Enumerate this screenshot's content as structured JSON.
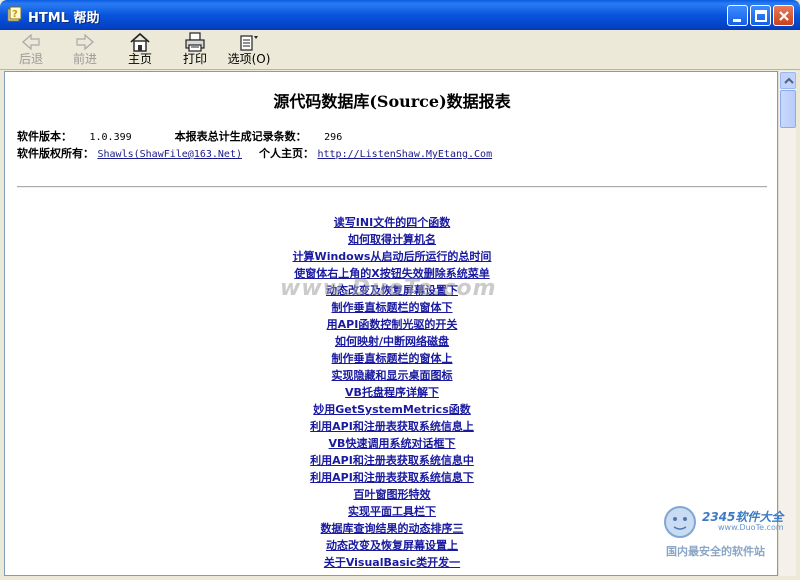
{
  "window": {
    "title": "HTML 帮助"
  },
  "toolbar": {
    "back_label": "后退",
    "forward_label": "前进",
    "home_label": "主页",
    "print_label": "打印",
    "options_label": "选项(O)"
  },
  "report": {
    "title": "源代码数据库(Source)数据报表",
    "version_label": "软件版本：",
    "version_value": "1.0.399",
    "count_label": "本报表总计生成记录条数：",
    "count_value": "296",
    "copyright_label": "软件版权所有：",
    "copyright_value": "Shawls(ShawFile@163.Net)",
    "homepage_label": "个人主页：",
    "homepage_value": "http://ListenShaw.MyEtang.Com"
  },
  "links": [
    "读写INI文件的四个函数",
    "如何取得计算机名",
    "计算Windows从启动后所运行的总时间",
    "使窗体右上角的X按钮失效删除系统菜单",
    "动态改变及恢复屏幕设置下",
    "制作垂直标题栏的窗体下",
    "用API函数控制光驱的开关",
    "如何映射/中断网络磁盘",
    "制作垂直标题栏的窗体上",
    "实现隐藏和显示桌面图标",
    "VB托盘程序详解下",
    "妙用GetSystemMetrics函数",
    "利用API和注册表获取系统信息上",
    "VB快速调用系统对话框下",
    "利用API和注册表获取系统信息中",
    "利用API和注册表获取系统信息下",
    "百叶窗图形特效",
    "实现平面工具栏下",
    "数据库查询结果的动态排序三",
    "动态改变及恢复屏幕设置上",
    "关于VisualBasic类开发一"
  ],
  "watermark": {
    "center": "www.DuoTe.com",
    "brand": "2345软件大全",
    "site": "www.DuoTe.com",
    "slogan": "国内最安全的软件站"
  },
  "icons": {
    "title": "help-icon",
    "back": "back-arrow-icon",
    "forward": "forward-arrow-icon",
    "home": "home-icon",
    "print": "printer-icon",
    "options": "options-icon"
  }
}
